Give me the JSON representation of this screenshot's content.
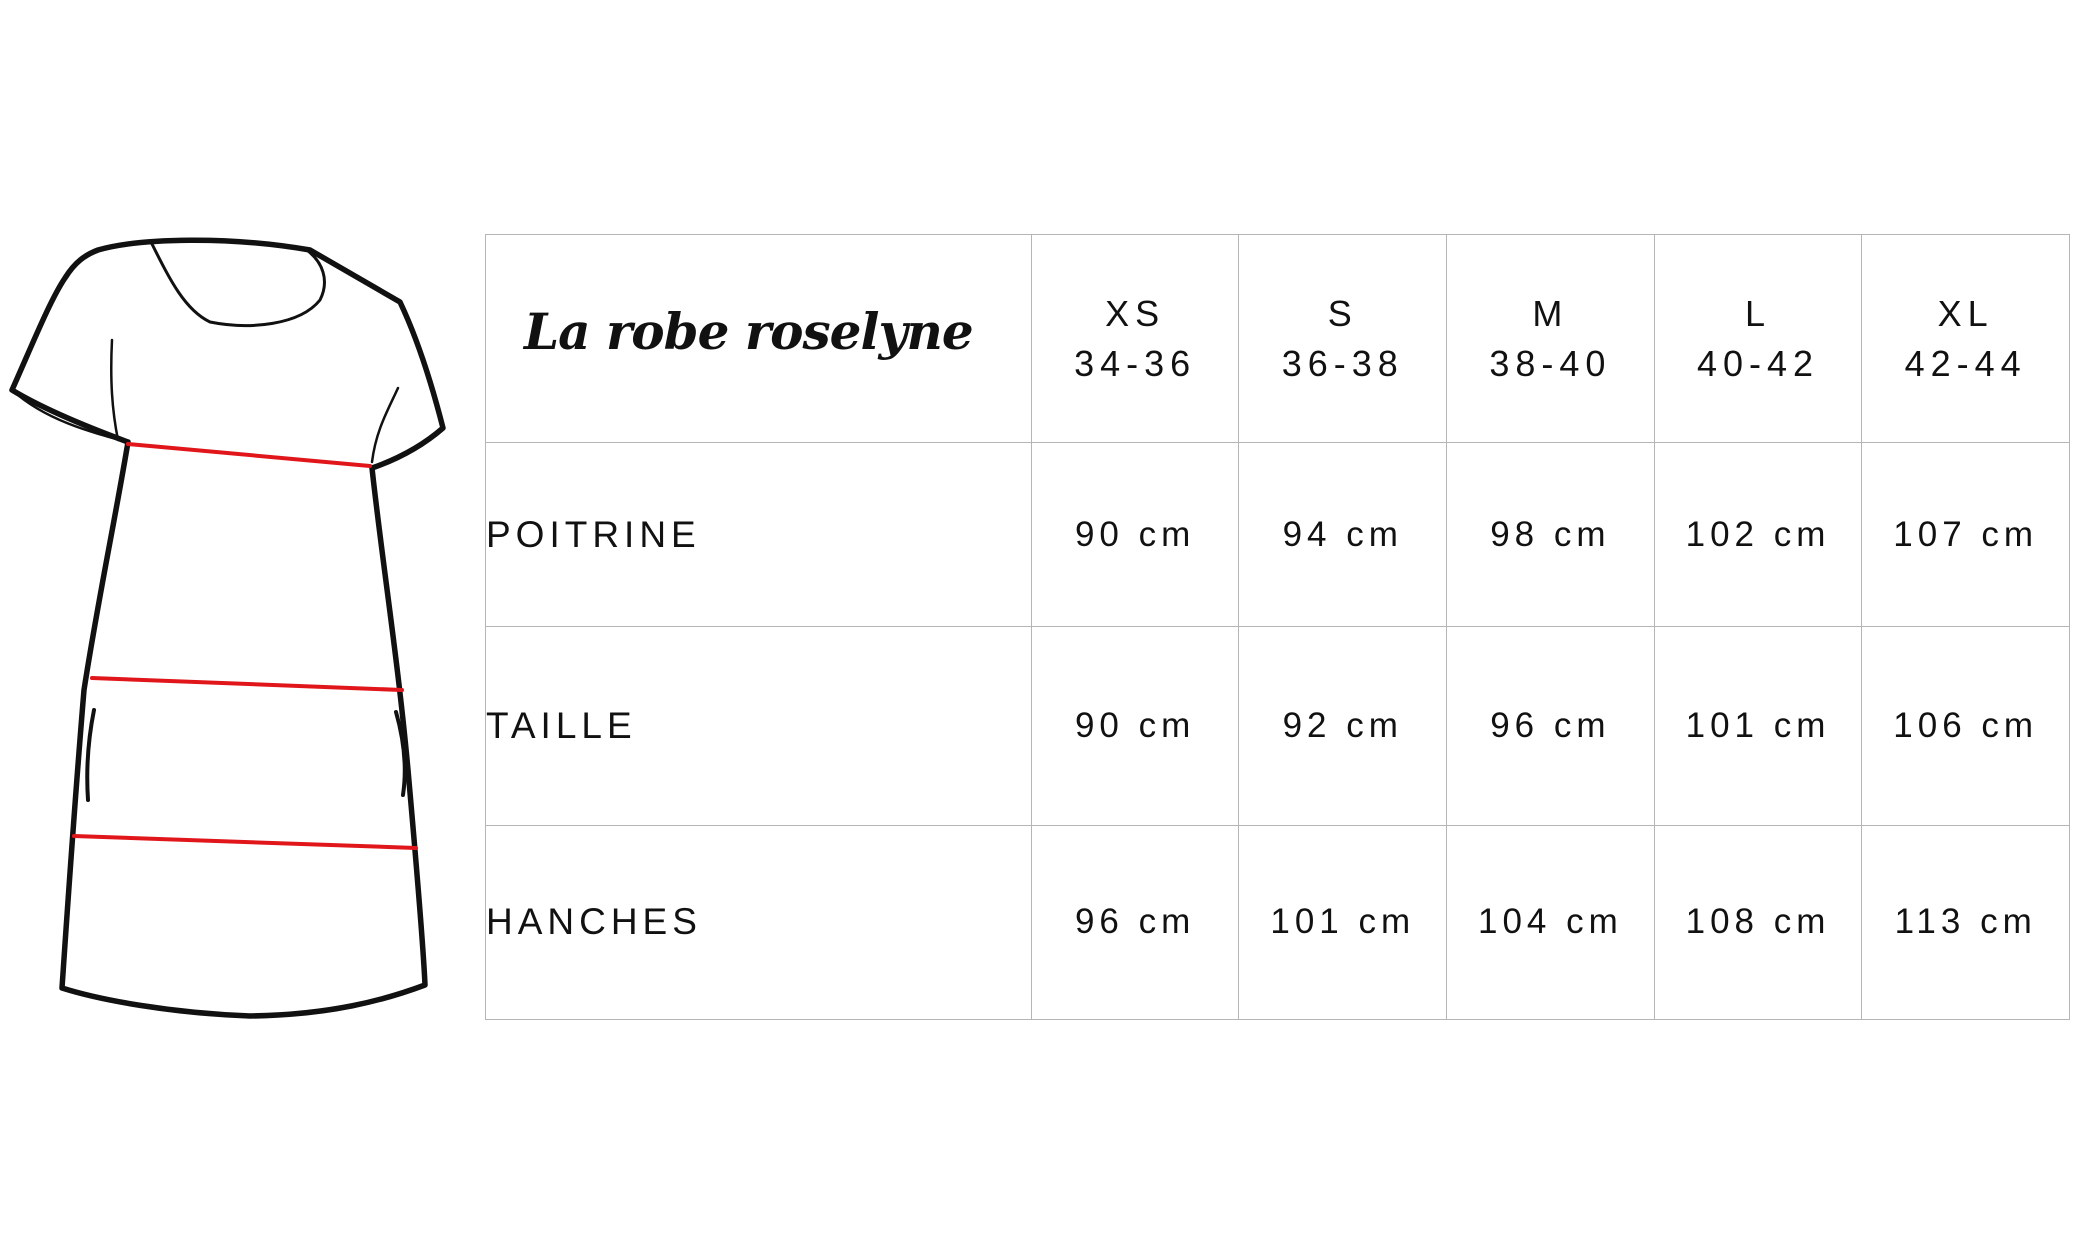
{
  "table": {
    "title": "La robe roselyne",
    "sizes": [
      {
        "size": "XS",
        "range": "34-36"
      },
      {
        "size": "S",
        "range": "36-38"
      },
      {
        "size": "M",
        "range": "38-40"
      },
      {
        "size": "L",
        "range": "40-42"
      },
      {
        "size": "XL",
        "range": "42-44"
      }
    ],
    "rows": [
      {
        "label": "POITRINE",
        "values": [
          "90 cm",
          "94 cm",
          "98 cm",
          "102 cm",
          "107 cm"
        ]
      },
      {
        "label": "TAILLE",
        "values": [
          "90 cm",
          "92 cm",
          "96 cm",
          "101 cm",
          "106 cm"
        ]
      },
      {
        "label": "HANCHES",
        "values": [
          "96 cm",
          "101 cm",
          "104 cm",
          "108 cm",
          "113 cm"
        ]
      }
    ]
  },
  "illustration": {
    "subject": "dress-outline",
    "measure_line_color": "#e0161b",
    "outline_color": "#111111"
  }
}
